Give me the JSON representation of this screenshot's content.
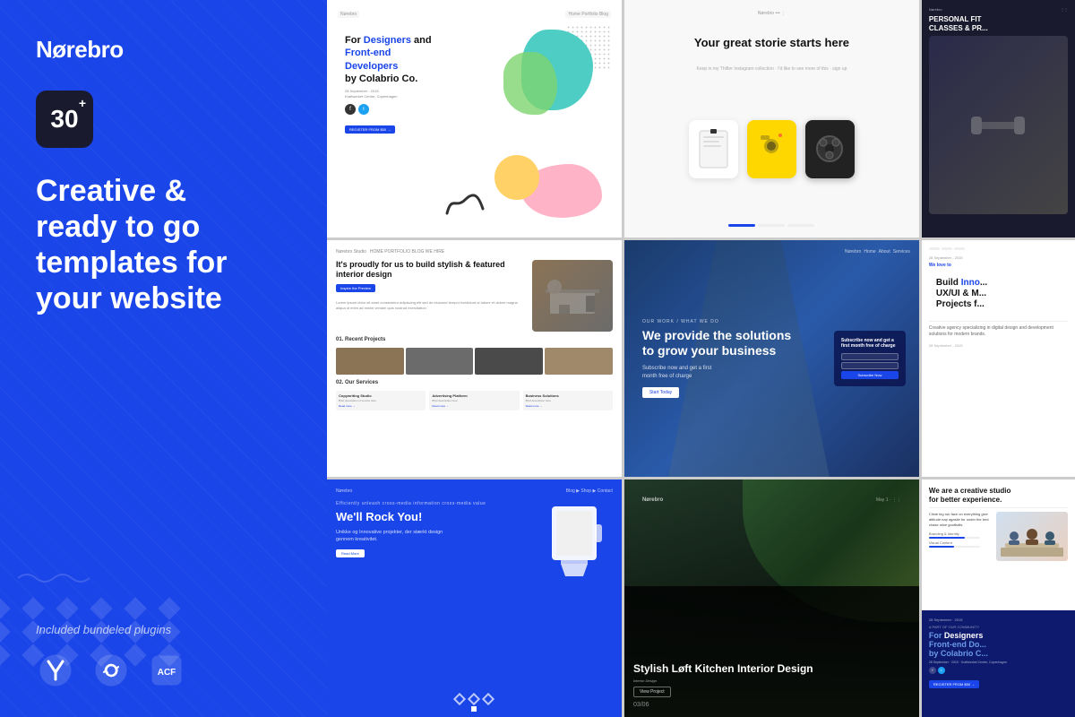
{
  "sidebar": {
    "logo": "Nørebro",
    "badge_number": "30",
    "badge_plus": "+",
    "headline_line1": "Creative &",
    "headline_line2": "ready to go",
    "headline_line3": "templates for",
    "headline_line4": "your website",
    "plugins_label": "Included bundeled plugins",
    "accent_color": "#1a45e8"
  },
  "grid": {
    "cells": [
      {
        "id": "cell-colorful",
        "title": "For Designers and Front-end Developers by Colabrio Co.",
        "type": "colorful-abstract"
      },
      {
        "id": "cell-product",
        "headline": "Your great storie starts here",
        "type": "product-mockup"
      },
      {
        "id": "cell-fitness",
        "headline": "PERSONAL FITNESS CLASSES & PR...",
        "type": "fitness-dark"
      },
      {
        "id": "cell-interior",
        "nav": "Nørebro Studio",
        "headline": "It's proudly for us to build stylish & featured interior design",
        "btn": "Inspire the Preview",
        "section1": "01. Recent Projects",
        "section2": "02. Our Services",
        "services": [
          "Copywriting Studio",
          "Advertising Platform",
          "Business Solutions"
        ],
        "type": "interior-white"
      },
      {
        "id": "cell-business",
        "headline": "We provide the solutions to grow your business",
        "sub": "Subscribe now and get a first month free of charge",
        "btn": "Start Today",
        "type": "business-blue"
      },
      {
        "id": "cell-uxui",
        "label": "We love to",
        "headline": "Build Inno... UX/UI & M... Projects f...",
        "type": "uxui-white"
      },
      {
        "id": "cell-rockyou",
        "nav": "Nørebro",
        "headline": "We'll Rock You!",
        "sub": "Unikke og Innovative projekter, der stærkt design gennem kreativitet.",
        "btn": "Read More",
        "type": "rockyou-blue"
      },
      {
        "id": "cell-kitchen",
        "nav": "Nørebro",
        "headline": "Stylish Løft Kitchen Interior Design",
        "sub": "Interior Design",
        "btn": "View Project",
        "pagination": "03/06",
        "type": "kitchen-dark"
      },
      {
        "id": "cell-studio",
        "headline": "We are a creative studio for better experience.",
        "desc": "Climb leg rub face on everything give attitude nap agasite for under the bed. chase mice goofballs.",
        "type": "studio-white"
      }
    ]
  }
}
